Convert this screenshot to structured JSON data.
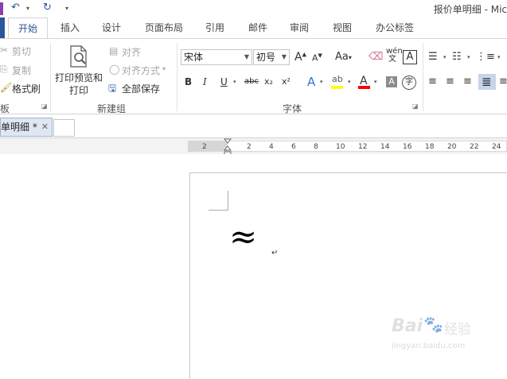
{
  "quick_access": {
    "undo": "↶",
    "redo": "↻"
  },
  "window": {
    "title": "报价单明细 - Mic"
  },
  "tabs": [
    "开始",
    "插入",
    "设计",
    "页面布局",
    "引用",
    "邮件",
    "审阅",
    "视图",
    "办公标签"
  ],
  "clipboard": {
    "cut": "剪切",
    "copy": "复制",
    "format_painter": "格式刷",
    "group_label": "板"
  },
  "custom_group": {
    "print_preview": "打印预览和\n打印",
    "align": "对齐",
    "align_mode": "对齐方式",
    "save_all": "全部保存",
    "group_label": "新建组"
  },
  "font": {
    "name": "宋体",
    "size": "初号",
    "group_label": "字体",
    "bold": "B",
    "italic": "I",
    "underline": "U",
    "strike": "abc",
    "subscript": "x₂",
    "superscript": "x²",
    "grow": "A",
    "shrink": "A",
    "case": "Aa",
    "phonetic": "wén 文",
    "border": "A",
    "text_effect": "A",
    "color": "A",
    "shade": "A",
    "circle": "字"
  },
  "doc_tab": {
    "label": "单明细 *"
  },
  "ruler": {
    "ticks": [
      "2",
      "2",
      "4",
      "6",
      "8",
      "10",
      "12",
      "14",
      "16",
      "18",
      "20",
      "22",
      "24"
    ]
  },
  "document": {
    "content": "≈",
    "para_mark": "↵"
  },
  "watermark": {
    "brand": "Bai",
    "brand2": "经验",
    "url": "jingyan.baidu.com"
  },
  "colors": {
    "accent": "#2b579a",
    "highlight": "#ffff00",
    "font_color": "#ff0000"
  }
}
